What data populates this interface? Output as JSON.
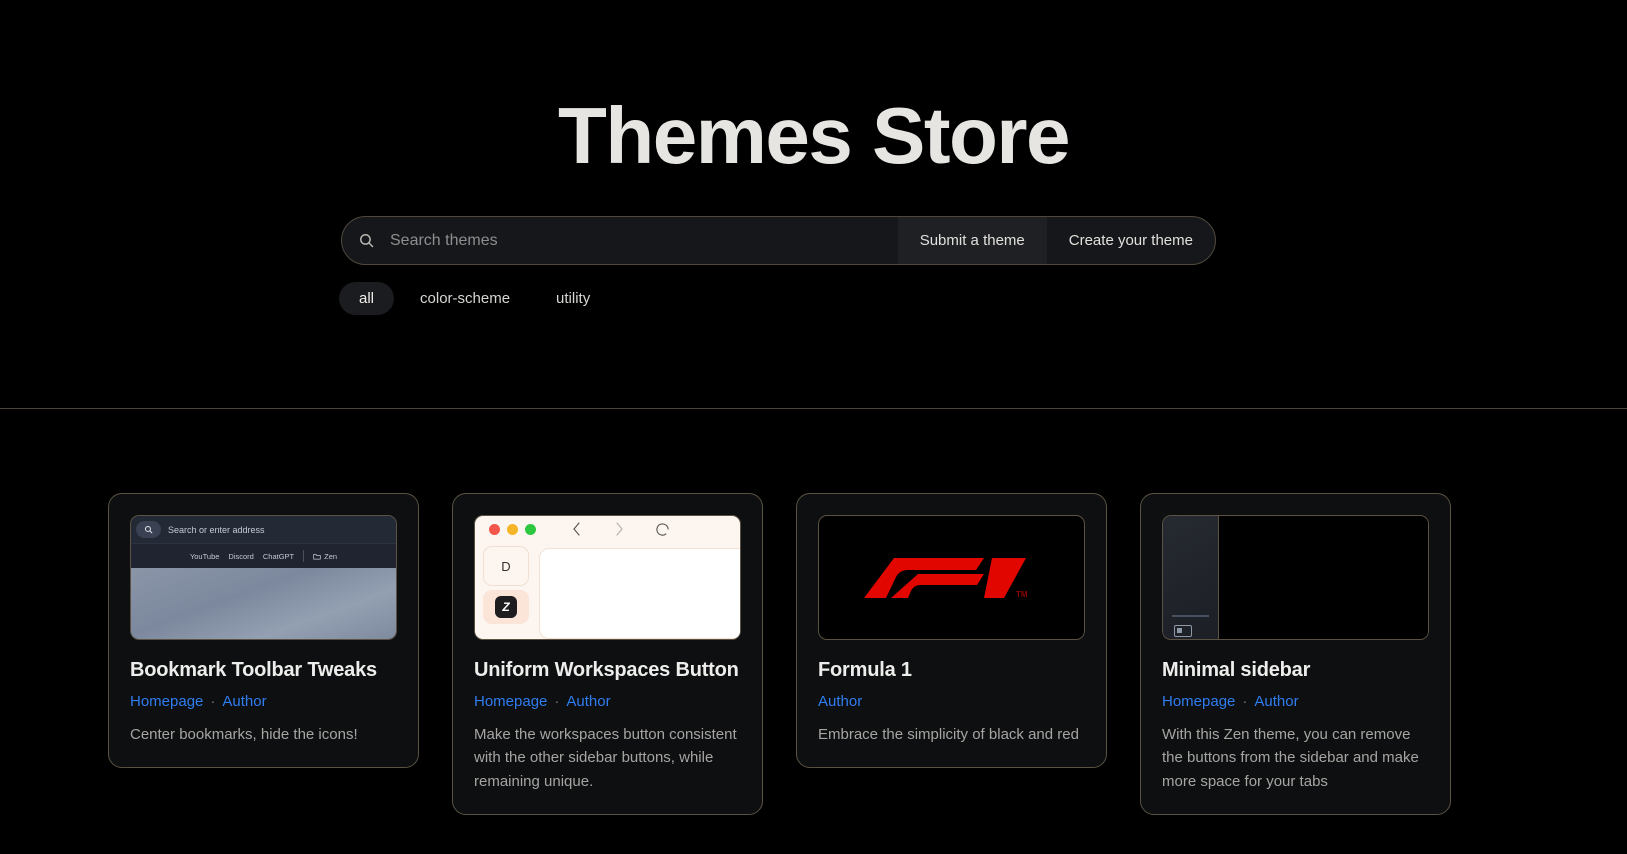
{
  "header": {
    "title": "Themes Store",
    "search": {
      "placeholder": "Search themes",
      "value": "",
      "icon": "search-icon"
    },
    "actions": [
      {
        "label": "Submit a theme",
        "style": "filled"
      },
      {
        "label": "Create your theme",
        "style": "plain"
      }
    ],
    "filters": [
      {
        "label": "all",
        "active": true
      },
      {
        "label": "color-scheme",
        "active": false
      },
      {
        "label": "utility",
        "active": false
      }
    ]
  },
  "cards": [
    {
      "title": "Bookmark Toolbar Tweaks",
      "links": [
        "Homepage",
        "Author"
      ],
      "separator": "·",
      "description": "Center bookmarks, hide the icons!",
      "preview": {
        "type": "bookmark-toolbar",
        "address_placeholder": "Search or enter address",
        "bookmarks": [
          "YouTube",
          "Discord",
          "ChatGPT"
        ],
        "folder": "Zen"
      }
    },
    {
      "title": "Uniform Workspaces Button",
      "links": [
        "Homepage",
        "Author"
      ],
      "separator": "·",
      "description": "Make the workspaces button consistent with the other sidebar buttons, while remaining unique.",
      "preview": {
        "type": "mac-browser",
        "workspace_letter": "D",
        "zen_glyph": "Z"
      }
    },
    {
      "title": "Formula 1",
      "links": [
        "Author"
      ],
      "separator": "·",
      "description": "Embrace the simplicity of black and red",
      "preview": {
        "type": "f1-logo",
        "trademark": "TM",
        "logo_color": "#e10600"
      }
    },
    {
      "title": "Minimal sidebar",
      "links": [
        "Homepage",
        "Author"
      ],
      "separator": "·",
      "description": "With this Zen theme, you can remove the buttons from the sidebar and make more space for your tabs",
      "preview": {
        "type": "minimal-sidebar"
      }
    }
  ],
  "colors": {
    "background": "#000000",
    "card_background": "#0e0f11",
    "card_border": "#5b5243",
    "link": "#2f7df0",
    "title_text": "#e7e5e2",
    "body_text": "#a6a5a2",
    "accent_red": "#e10600"
  }
}
